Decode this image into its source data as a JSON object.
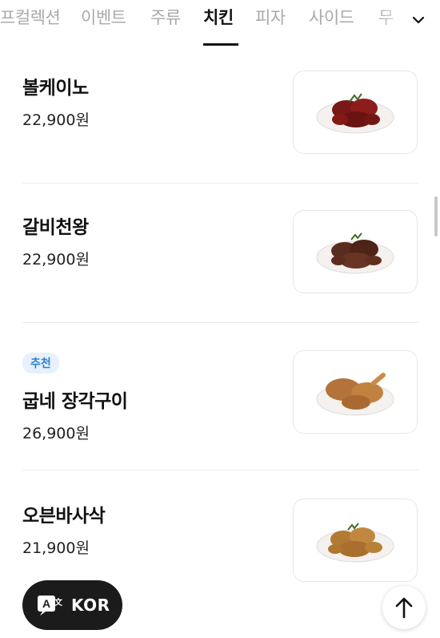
{
  "tabs": [
    {
      "label": "프컬렉션",
      "active": false
    },
    {
      "label": "이벤트",
      "active": false
    },
    {
      "label": "주류",
      "active": false
    },
    {
      "label": "치킨",
      "active": true
    },
    {
      "label": "피자",
      "active": false
    },
    {
      "label": "사이드",
      "active": false
    },
    {
      "label": "무",
      "active": false
    }
  ],
  "expand_icon": "chevron-down-icon",
  "menu_items": [
    {
      "name": "볼케이노",
      "price": "22,900원",
      "badge": "",
      "dish_color": "#7a1717"
    },
    {
      "name": "갈비천왕",
      "price": "22,900원",
      "badge": "",
      "dish_color": "#5a2c1f"
    },
    {
      "name": "굽네 장각구이",
      "price": "26,900원",
      "badge": "추천",
      "dish_color": "#b4733a"
    },
    {
      "name": "오븐바사삭",
      "price": "21,900원",
      "badge": "",
      "dish_color": "#b27a34"
    }
  ],
  "language_button": {
    "label": "KOR",
    "icon": "translate-icon"
  },
  "scroll_top_button": {
    "icon": "arrow-up-icon"
  },
  "colors": {
    "badge_bg": "#e7f1fb",
    "badge_text": "#2f7fd1",
    "fab_bg": "#1b1b1b"
  }
}
